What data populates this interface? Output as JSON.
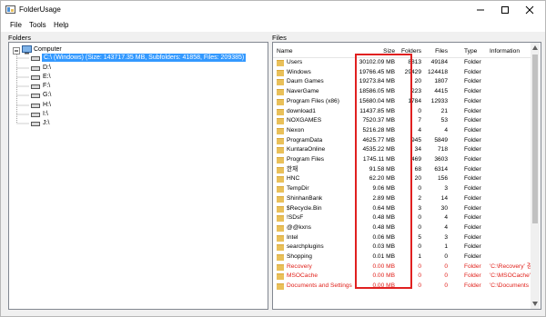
{
  "window": {
    "title": "FolderUsage"
  },
  "menu": [
    "File",
    "Tools",
    "Help"
  ],
  "panes": {
    "folders_label": "Folders",
    "files_label": "Files"
  },
  "tree": {
    "root": "Computer",
    "drives": [
      {
        "label": "C:\\ (Windows) (Size: 143717.35 MB, Subfolders: 41858, Files: 209385)",
        "selected": true
      },
      {
        "label": "D:\\"
      },
      {
        "label": "E:\\"
      },
      {
        "label": "F:\\"
      },
      {
        "label": "G:\\"
      },
      {
        "label": "H:\\"
      },
      {
        "label": "I:\\"
      },
      {
        "label": "J:\\"
      }
    ]
  },
  "list": {
    "headers": {
      "name": "Name",
      "size": "Size",
      "folders": "Folders",
      "files": "Files",
      "type": "Type",
      "info": "Information"
    },
    "rows": [
      {
        "name": "Users",
        "size": "30102.09 MB",
        "folders": "8813",
        "files": "49184",
        "type": "Folder",
        "info": ""
      },
      {
        "name": "Windows",
        "size": "19766.45 MB",
        "folders": "29429",
        "files": "124418",
        "type": "Folder",
        "info": ""
      },
      {
        "name": "Daum Games",
        "size": "19273.84 MB",
        "folders": "20",
        "files": "1807",
        "type": "Folder",
        "info": ""
      },
      {
        "name": "NaverGame",
        "size": "18586.05 MB",
        "folders": "223",
        "files": "4415",
        "type": "Folder",
        "info": ""
      },
      {
        "name": "Program Files (x86)",
        "size": "15680.04 MB",
        "folders": "1784",
        "files": "12933",
        "type": "Folder",
        "info": ""
      },
      {
        "name": "download1",
        "size": "11437.85 MB",
        "folders": "0",
        "files": "21",
        "type": "Folder",
        "info": ""
      },
      {
        "name": "NOXGAMES",
        "size": "7520.37 MB",
        "folders": "7",
        "files": "53",
        "type": "Folder",
        "info": ""
      },
      {
        "name": "Nexon",
        "size": "5216.28 MB",
        "folders": "4",
        "files": "4",
        "type": "Folder",
        "info": ""
      },
      {
        "name": "ProgramData",
        "size": "4625.77 MB",
        "folders": "945",
        "files": "5849",
        "type": "Folder",
        "info": ""
      },
      {
        "name": "KuntaraOnline",
        "size": "4535.22 MB",
        "folders": "34",
        "files": "718",
        "type": "Folder",
        "info": ""
      },
      {
        "name": "Program Files",
        "size": "1745.11 MB",
        "folders": "469",
        "files": "3603",
        "type": "Folder",
        "info": ""
      },
      {
        "name": "한재",
        "size": "91.58 MB",
        "folders": "68",
        "files": "6314",
        "type": "Folder",
        "info": ""
      },
      {
        "name": "HNC",
        "size": "62.20 MB",
        "folders": "20",
        "files": "156",
        "type": "Folder",
        "info": ""
      },
      {
        "name": "TempDir",
        "size": "9.06 MB",
        "folders": "0",
        "files": "3",
        "type": "Folder",
        "info": ""
      },
      {
        "name": "ShinhanBank",
        "size": "2.89 MB",
        "folders": "2",
        "files": "14",
        "type": "Folder",
        "info": ""
      },
      {
        "name": "$Recycle.Bin",
        "size": "0.64 MB",
        "folders": "3",
        "files": "30",
        "type": "Folder",
        "info": ""
      },
      {
        "name": "!SDsF",
        "size": "0.48 MB",
        "folders": "0",
        "files": "4",
        "type": "Folder",
        "info": ""
      },
      {
        "name": "@@kxns",
        "size": "0.48 MB",
        "folders": "0",
        "files": "4",
        "type": "Folder",
        "info": ""
      },
      {
        "name": "Intel",
        "size": "0.06 MB",
        "folders": "5",
        "files": "3",
        "type": "Folder",
        "info": ""
      },
      {
        "name": "searchplugins",
        "size": "0.03 MB",
        "folders": "0",
        "files": "1",
        "type": "Folder",
        "info": ""
      },
      {
        "name": "Shopping",
        "size": "0.01 MB",
        "folders": "1",
        "files": "0",
        "type": "Folder",
        "info": ""
      },
      {
        "name": "Recovery",
        "size": "0.00 MB",
        "folders": "0",
        "files": "0",
        "type": "Folder",
        "info": "'C:\\Recovery' 경",
        "error": true
      },
      {
        "name": "MSOCache",
        "size": "0.00 MB",
        "folders": "0",
        "files": "0",
        "type": "Folder",
        "info": "'C:\\MSOCache' ,",
        "error": true
      },
      {
        "name": "Documents and Settings",
        "size": "0.00 MB",
        "folders": "0",
        "files": "0",
        "type": "Folder",
        "info": "'C:\\Documents a",
        "error": true
      }
    ]
  },
  "colors": {
    "selection": "#3399ff",
    "error_text": "#e0201a",
    "highlight_box": "#e02020",
    "folder": "#e9c05a"
  }
}
